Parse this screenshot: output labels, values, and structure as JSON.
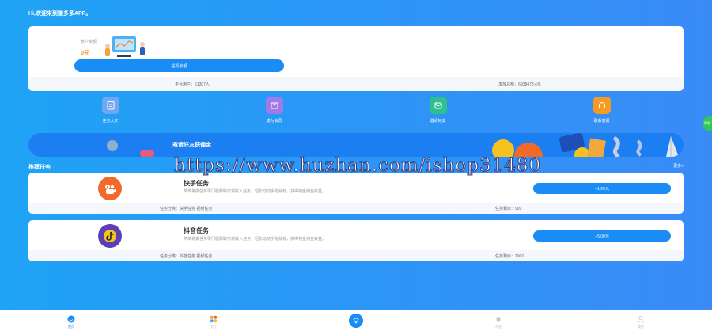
{
  "header": {
    "greeting": "Hi,欢迎来到赚多多APP。"
  },
  "balance": {
    "label": "账户余额",
    "value": "0元",
    "withdraw_label": "提现余额",
    "stats": [
      {
        "text": "平台用户：51307人"
      },
      {
        "text": "发放总额：6938478.4元"
      }
    ]
  },
  "quick_menu": [
    {
      "label": "任务大厅",
      "icon": "clipboard-icon",
      "color": "#6fa8f0"
    },
    {
      "label": "成为会员",
      "icon": "crown-icon",
      "color": "#a07be8"
    },
    {
      "label": "邀请好友",
      "icon": "envelope-icon",
      "color": "#2fc08f"
    },
    {
      "label": "联系客服",
      "icon": "headset-icon",
      "color": "#f59a22"
    }
  ],
  "banner": {
    "title": "邀请好友获佣金"
  },
  "recommend": {
    "title": "推荐任务",
    "more": "更多>"
  },
  "tasks": [
    {
      "name": "快手任务",
      "desc": "简单易做任务零门槛赚取可观收入任务，轻松动动手指就有，获得佣金佣金收益。",
      "reward": "+1.20元",
      "category": "任务分类：快手任务 视频任务",
      "remaining": "任务剩余：999",
      "avatar_color": "#f06a2a",
      "icon": "kuaishou-icon"
    },
    {
      "name": "抖音任务",
      "desc": "简单易做任务零门槛赚取可观收入任务，轻松动动手指就有，获得佣金佣金收益。",
      "reward": "+5.00元",
      "category": "任务分类：抖音任务 视频任务",
      "remaining": "任务剩余：1000",
      "avatar_color": "#5a3fb8",
      "icon": "douyin-icon"
    }
  ],
  "watermark": "https://www.huzhan.com/ishop31480",
  "side_tab": "帮助",
  "bottom_nav": [
    {
      "label": "首页",
      "icon": "home-icon"
    },
    {
      "label": "大厅",
      "icon": "hall-icon"
    },
    {
      "label": "",
      "icon": "diamond-icon"
    },
    {
      "label": "消息",
      "icon": "bell-icon"
    },
    {
      "label": "我的",
      "icon": "user-icon"
    }
  ],
  "colors": {
    "primary": "#1a8cf5",
    "accent": "#f5841f"
  }
}
